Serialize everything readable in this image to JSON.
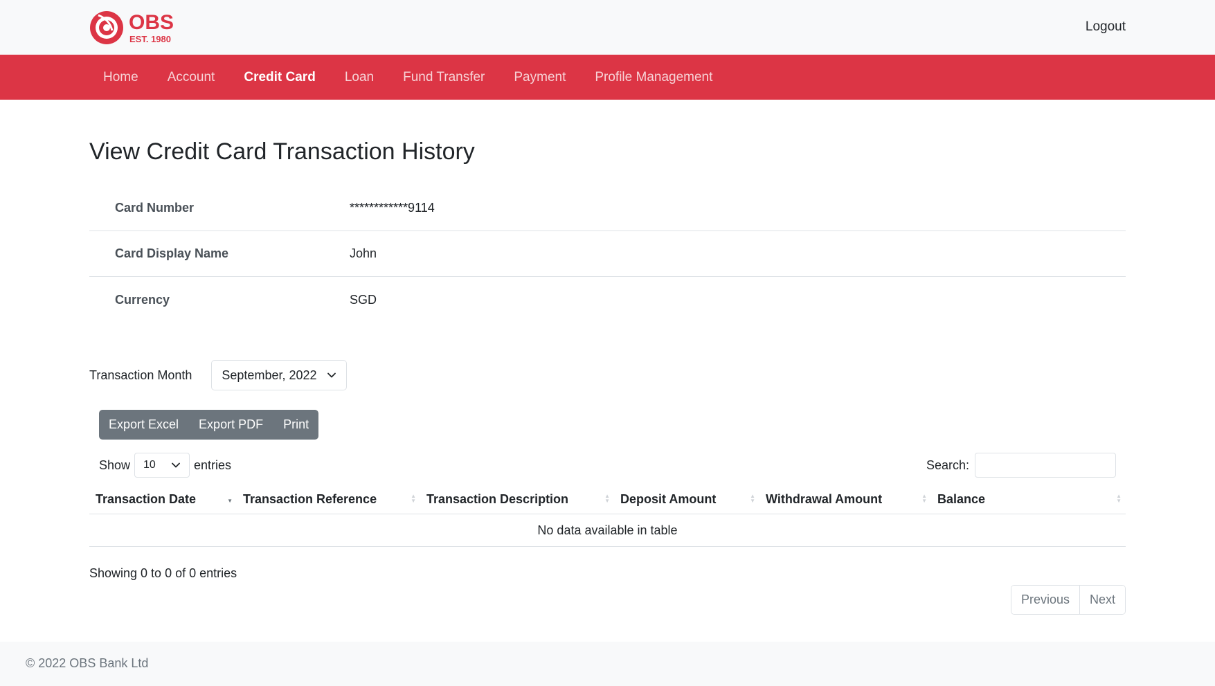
{
  "brand": {
    "name": "OBS",
    "tagline": "EST. 1980",
    "color": "#dc3545"
  },
  "header": {
    "logout_label": "Logout"
  },
  "nav": {
    "items": [
      {
        "label": "Home",
        "active": false
      },
      {
        "label": "Account",
        "active": false
      },
      {
        "label": "Credit Card",
        "active": true
      },
      {
        "label": "Loan",
        "active": false
      },
      {
        "label": "Fund Transfer",
        "active": false
      },
      {
        "label": "Payment",
        "active": false
      },
      {
        "label": "Profile Management",
        "active": false
      }
    ]
  },
  "page": {
    "title": "View Credit Card Transaction History"
  },
  "card_info": {
    "rows": [
      {
        "label": "Card Number",
        "value": "************9114"
      },
      {
        "label": "Card Display Name",
        "value": "John"
      },
      {
        "label": "Currency",
        "value": "SGD"
      }
    ]
  },
  "filter": {
    "month_label": "Transaction Month",
    "month_value": "September, 2022"
  },
  "export": {
    "excel_label": "Export Excel",
    "pdf_label": "Export PDF",
    "print_label": "Print"
  },
  "table_controls": {
    "show_label": "Show",
    "page_length": "10",
    "entries_label": "entries",
    "search_label": "Search:",
    "search_value": ""
  },
  "table": {
    "columns": [
      "Transaction Date",
      "Transaction Reference",
      "Transaction Description",
      "Deposit Amount",
      "Withdrawal Amount",
      "Balance"
    ],
    "sorted_column": "Transaction Date",
    "empty_message": "No data available in table"
  },
  "pagination": {
    "info": "Showing 0 to 0 of 0 entries",
    "previous_label": "Previous",
    "next_label": "Next"
  },
  "footer": {
    "text": "© 2022 OBS Bank Ltd"
  }
}
